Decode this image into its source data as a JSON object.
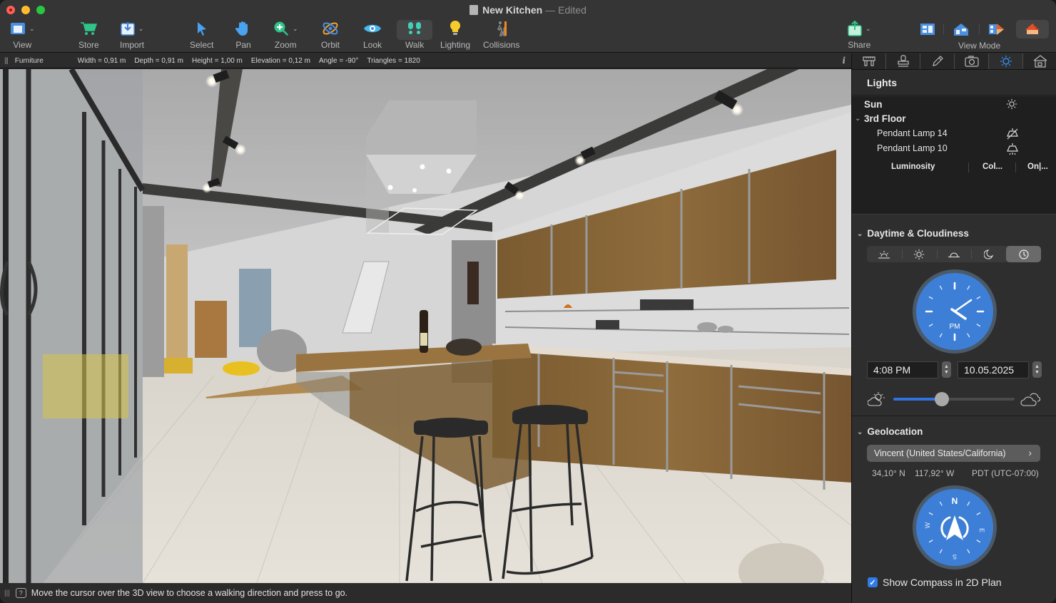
{
  "window": {
    "title": "New Kitchen",
    "title_separator": "—",
    "edited_label": "Edited"
  },
  "toolbar": {
    "view": {
      "label": "View",
      "icon": "view-layout-icon"
    },
    "store": {
      "label": "Store",
      "icon": "cart-icon"
    },
    "import": {
      "label": "Import",
      "icon": "import-icon"
    },
    "select": {
      "label": "Select",
      "icon": "cursor-arrow-icon"
    },
    "pan": {
      "label": "Pan",
      "icon": "hand-icon"
    },
    "zoom": {
      "label": "Zoom",
      "icon": "zoom-plus-icon"
    },
    "orbit": {
      "label": "Orbit",
      "icon": "orbit-icon"
    },
    "look": {
      "label": "Look",
      "icon": "eye-icon"
    },
    "walk": {
      "label": "Walk",
      "icon": "footprints-icon",
      "active": true
    },
    "lighting": {
      "label": "Lighting",
      "icon": "lightbulb-icon"
    },
    "collisions": {
      "label": "Collisions",
      "icon": "collision-walker-icon"
    },
    "share": {
      "label": "Share",
      "icon": "share-icon"
    },
    "view_mode": {
      "label": "View Mode",
      "options": [
        "2D Plan",
        "3D Section",
        "Split View",
        "3D View"
      ],
      "selected": "3D View"
    }
  },
  "infobar": {
    "category": "Furniture",
    "measurements": [
      "Width = 0,91 m",
      "Depth = 0,91 m",
      "Height = 1,00 m",
      "Elevation = 0,12 m",
      "Angle = -90°",
      "Triangles = 1820"
    ],
    "info_label": "i"
  },
  "statusbar": {
    "message": "Move the cursor over the 3D view to choose a walking direction and press to go."
  },
  "panel": {
    "tabs": [
      {
        "name": "measure",
        "icon": "caliper-icon"
      },
      {
        "name": "stamp",
        "icon": "stamp-icon"
      },
      {
        "name": "edit",
        "icon": "pencil-icon"
      },
      {
        "name": "camera",
        "icon": "camera-icon"
      },
      {
        "name": "lights",
        "icon": "sun-icon",
        "active": true
      },
      {
        "name": "building",
        "icon": "house-icon"
      }
    ],
    "lights": {
      "title": "Lights",
      "sun_label": "Sun",
      "group_label": "3rd Floor",
      "items": [
        {
          "label": "Pendant Lamp 14",
          "state": "off"
        },
        {
          "label": "Pendant Lamp 10",
          "state": "on"
        }
      ],
      "columns": [
        "Luminosity",
        "Col...",
        "On|..."
      ]
    },
    "daytime": {
      "title": "Daytime & Cloudiness",
      "modes": [
        "sunrise",
        "noon",
        "sunset",
        "night",
        "custom-time"
      ],
      "selected_mode": "custom-time",
      "clock_period": "PM",
      "time": "4:08 PM",
      "date": "10.05.2025",
      "cloudiness": 0.4
    },
    "geolocation": {
      "title": "Geolocation",
      "location": "Vincent (United States/California)",
      "latitude": "34,10° N",
      "longitude": "117,92° W",
      "timezone": "PDT (UTC-07:00)",
      "compass": {
        "n": "N",
        "e": "E",
        "s": "S",
        "w": "W"
      },
      "show_compass_label": "Show Compass in 2D Plan",
      "show_compass_checked": true
    }
  }
}
